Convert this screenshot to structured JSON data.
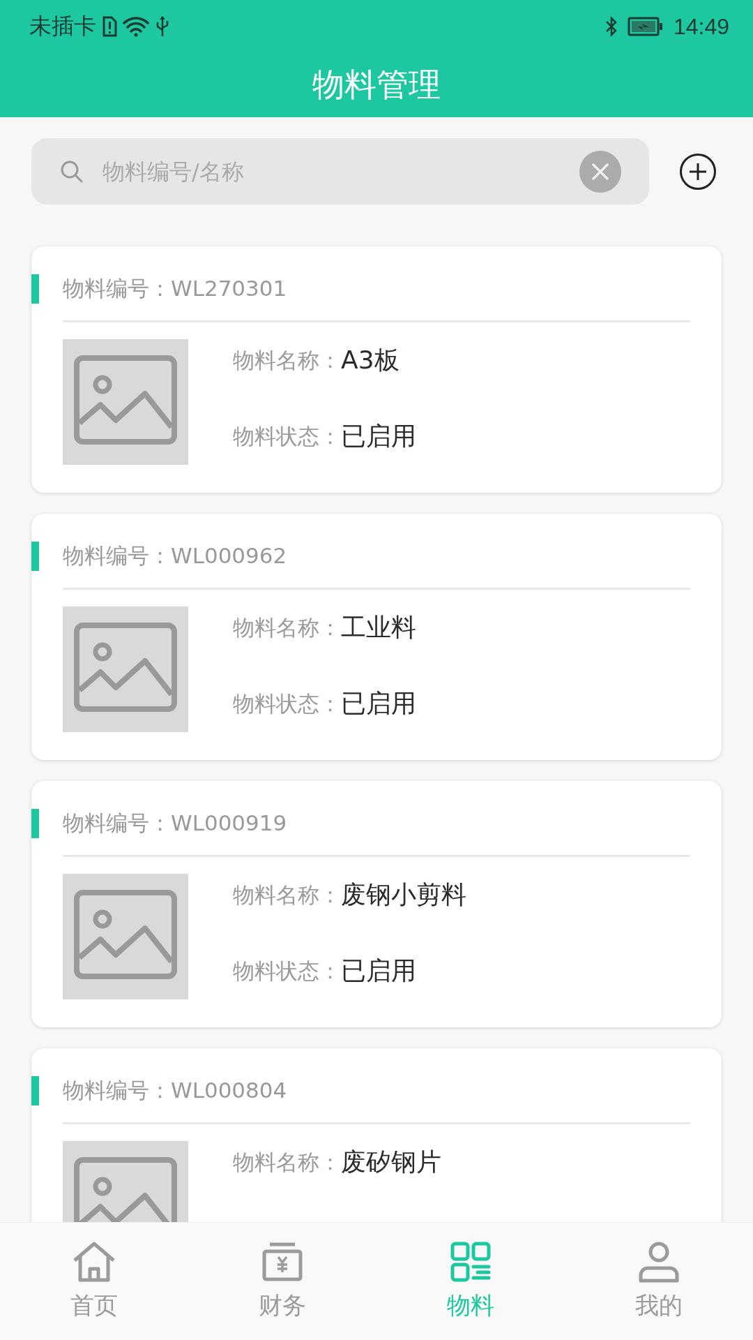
{
  "status_bar": {
    "carrier": "未插卡",
    "time": "14:49"
  },
  "header": {
    "title": "物料管理"
  },
  "search": {
    "placeholder": "物料编号/名称"
  },
  "materials": [
    {
      "code": "物料编号：WL270301",
      "fields": [
        {
          "label": "物料名称：",
          "value": "A3板"
        },
        {
          "label": "物料状态：",
          "value": "已启用"
        }
      ]
    },
    {
      "code": "物料编号：WL000962",
      "fields": [
        {
          "label": "物料名称：",
          "value": "工业料"
        },
        {
          "label": "物料状态：",
          "value": "已启用"
        }
      ]
    },
    {
      "code": "物料编号：WL000919",
      "fields": [
        {
          "label": "物料名称：",
          "value": "废钢小剪料"
        },
        {
          "label": "物料状态：",
          "value": "已启用"
        }
      ]
    },
    {
      "code": "物料编号：WL000804",
      "fields": [
        {
          "label": "物料名称：",
          "value": "废矽钢片"
        }
      ]
    }
  ],
  "tabs": [
    {
      "label": "首页",
      "kind": "home",
      "selected": false
    },
    {
      "label": "财务",
      "kind": "finance",
      "selected": false
    },
    {
      "label": "物料",
      "kind": "material",
      "selected": true
    },
    {
      "label": "我的",
      "kind": "profile",
      "selected": false
    }
  ]
}
